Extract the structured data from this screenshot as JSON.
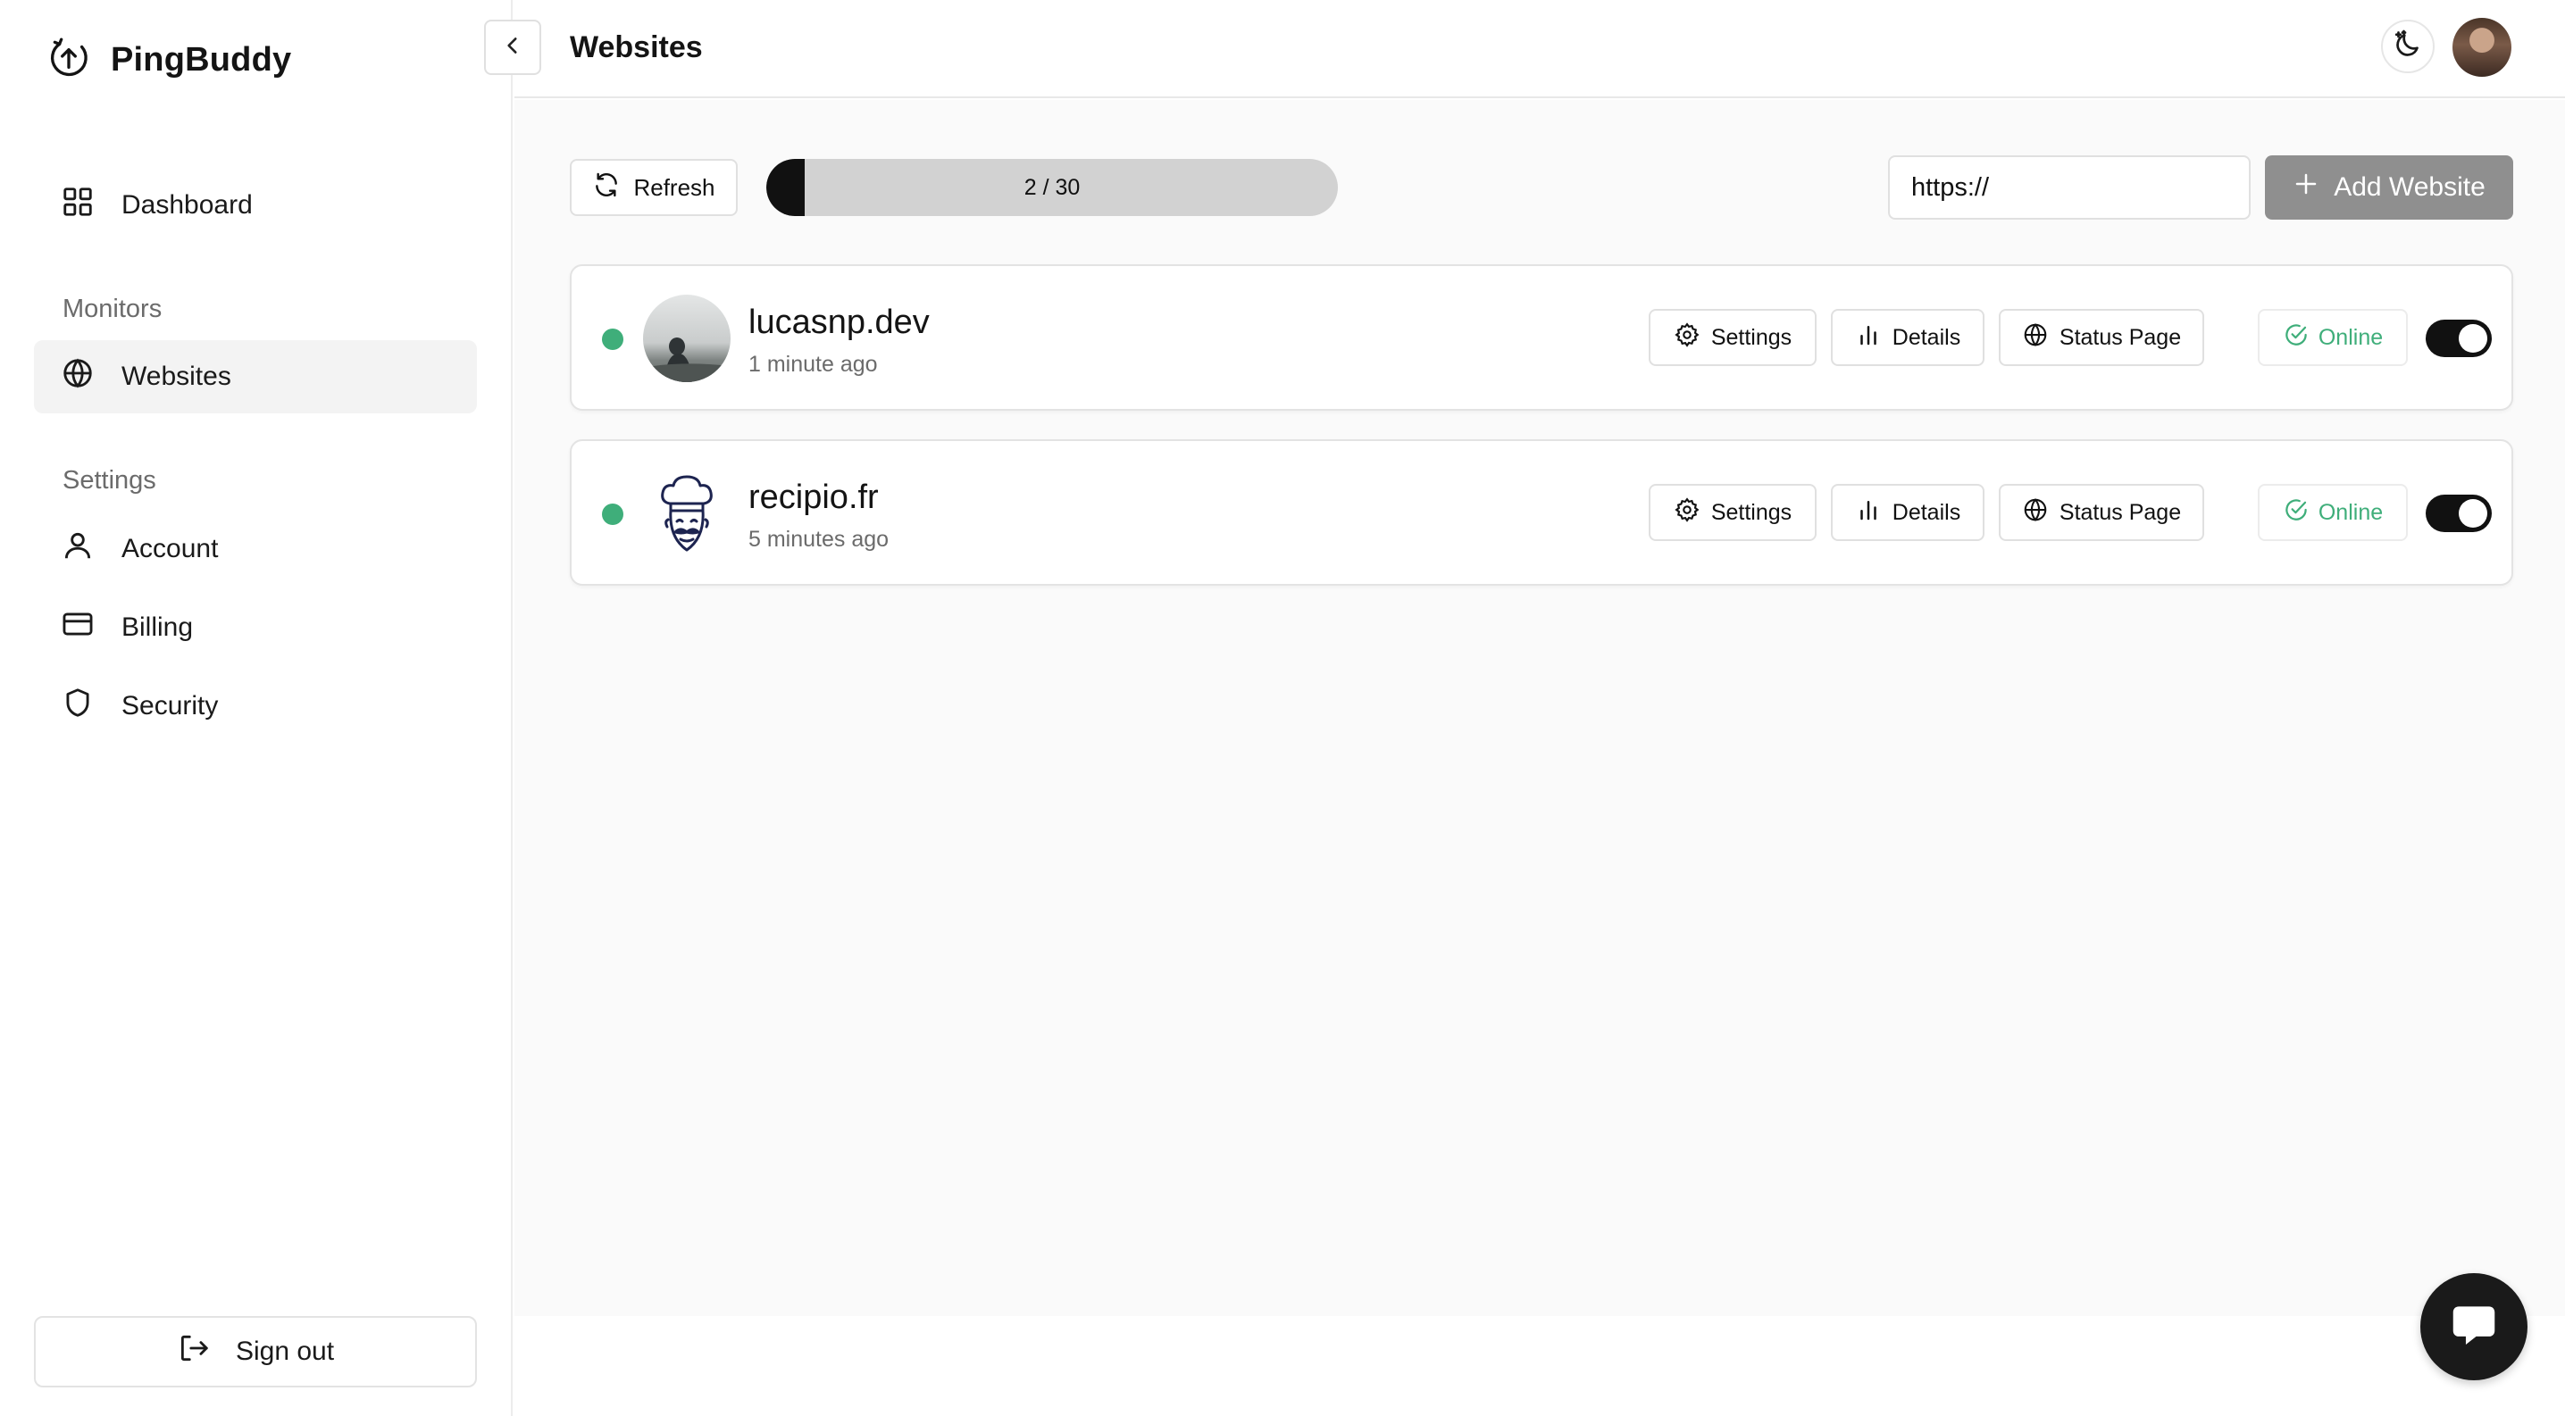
{
  "app": {
    "brand_name": "PingBuddy",
    "page_title": "Websites"
  },
  "sidebar": {
    "dashboard_label": "Dashboard",
    "monitors_section": "Monitors",
    "websites_label": "Websites",
    "settings_section": "Settings",
    "account_label": "Account",
    "billing_label": "Billing",
    "security_label": "Security",
    "signout_label": "Sign out"
  },
  "toolbar": {
    "refresh_label": "Refresh",
    "quota_text": "2 / 30",
    "quota_used": 2,
    "quota_total": 30,
    "url_placeholder": "https://",
    "add_label": "Add Website"
  },
  "websites": [
    {
      "name": "lucasnp.dev",
      "last_checked": "1 minute ago",
      "settings_label": "Settings",
      "details_label": "Details",
      "status_page_label": "Status Page",
      "status": "Online",
      "enabled": true
    },
    {
      "name": "recipio.fr",
      "last_checked": "5 minutes ago",
      "settings_label": "Settings",
      "details_label": "Details",
      "status_page_label": "Status Page",
      "status": "Online",
      "enabled": true
    }
  ],
  "colors": {
    "online": "#3fae7a",
    "primary": "#111111",
    "add_button": "#8f8f8f"
  }
}
